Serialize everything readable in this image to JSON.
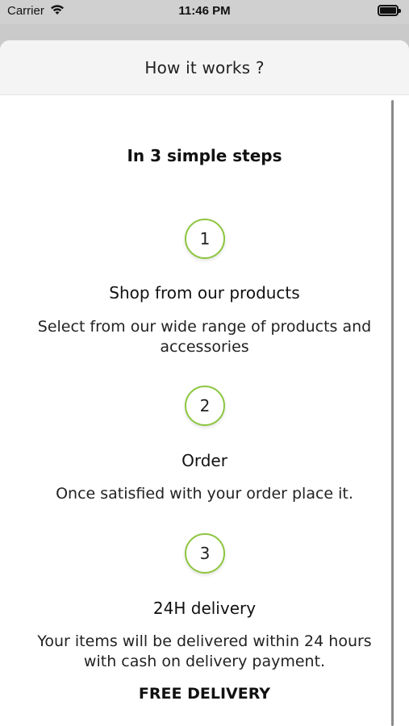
{
  "status_bar": {
    "carrier": "Carrier",
    "time": "11:46 PM"
  },
  "sheet": {
    "title": "How it works ?"
  },
  "intro": "In 3 simple steps",
  "steps": [
    {
      "number": "1",
      "title": "Shop from our products",
      "description": "Select from our wide range of products and accessories"
    },
    {
      "number": "2",
      "title": "Order",
      "description": "Once satisfied with your order place it."
    },
    {
      "number": "3",
      "title": "24H delivery",
      "description": "Your items will be delivered within 24 hours with cash on delivery payment."
    }
  ],
  "footer_note": "FREE DELIVERY",
  "colors": {
    "accent": "#8dc63f",
    "backdrop": "#c9cac9",
    "header_bg": "#f4f4f4"
  }
}
